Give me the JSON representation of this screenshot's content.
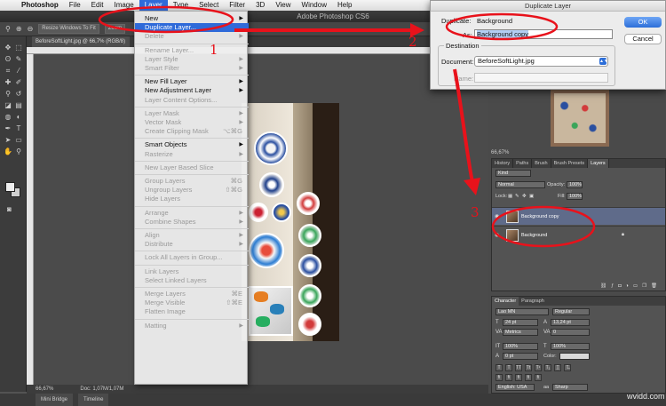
{
  "menubar": {
    "items": [
      "Photoshop",
      "File",
      "Edit",
      "Image",
      "Layer",
      "Type",
      "Select",
      "Filter",
      "3D",
      "View",
      "Window",
      "Help"
    ],
    "active": "Layer"
  },
  "titlebar": {
    "title": "Adobe Photoshop CS6"
  },
  "options": {
    "resize": "Resize Windows To Fit",
    "zoom": "Zoom"
  },
  "doc": {
    "tab": "BeforeSoftLight.jpg @ 66,7% (RGB/8)"
  },
  "layer_menu": {
    "items": [
      {
        "label": "New",
        "submenu": true
      },
      {
        "label": "Duplicate Layer...",
        "selected": true
      },
      {
        "label": "Delete",
        "disabled": true,
        "submenu": true
      },
      {
        "sep": true
      },
      {
        "label": "Rename Layer...",
        "disabled": true
      },
      {
        "label": "Layer Style",
        "disabled": true,
        "submenu": true
      },
      {
        "label": "Smart Filter",
        "disabled": true,
        "submenu": true
      },
      {
        "sep": true
      },
      {
        "label": "New Fill Layer",
        "submenu": true
      },
      {
        "label": "New Adjustment Layer",
        "submenu": true
      },
      {
        "label": "Layer Content Options...",
        "disabled": true
      },
      {
        "sep": true
      },
      {
        "label": "Layer Mask",
        "disabled": true,
        "submenu": true
      },
      {
        "label": "Vector Mask",
        "disabled": true,
        "submenu": true
      },
      {
        "label": "Create Clipping Mask",
        "disabled": true,
        "shortcut": "⌥⌘G"
      },
      {
        "sep": true
      },
      {
        "label": "Smart Objects",
        "submenu": true
      },
      {
        "label": "Rasterize",
        "disabled": true,
        "submenu": true
      },
      {
        "sep": true
      },
      {
        "label": "New Layer Based Slice",
        "disabled": true
      },
      {
        "sep": true
      },
      {
        "label": "Group Layers",
        "disabled": true,
        "shortcut": "⌘G"
      },
      {
        "label": "Ungroup Layers",
        "disabled": true,
        "shortcut": "⇧⌘G"
      },
      {
        "label": "Hide Layers",
        "disabled": true
      },
      {
        "sep": true
      },
      {
        "label": "Arrange",
        "disabled": true,
        "submenu": true
      },
      {
        "label": "Combine Shapes",
        "disabled": true,
        "submenu": true
      },
      {
        "sep": true
      },
      {
        "label": "Align",
        "disabled": true,
        "submenu": true
      },
      {
        "label": "Distribute",
        "disabled": true,
        "submenu": true
      },
      {
        "sep": true
      },
      {
        "label": "Lock All Layers in Group...",
        "disabled": true
      },
      {
        "sep": true
      },
      {
        "label": "Link Layers",
        "disabled": true
      },
      {
        "label": "Select Linked Layers",
        "disabled": true
      },
      {
        "sep": true
      },
      {
        "label": "Merge Layers",
        "disabled": true,
        "shortcut": "⌘E"
      },
      {
        "label": "Merge Visible",
        "disabled": true,
        "shortcut": "⇧⌘E"
      },
      {
        "label": "Flatten Image",
        "disabled": true
      },
      {
        "sep": true
      },
      {
        "label": "Matting",
        "disabled": true,
        "submenu": true
      }
    ]
  },
  "dialog": {
    "title": "Duplicate Layer",
    "duplicate_label": "Duplicate:",
    "duplicate_value": "Background",
    "as_label": "As:",
    "as_value": "Background copy",
    "ok": "OK",
    "cancel": "Cancel",
    "destination": "Destination",
    "document_label": "Document:",
    "document_value": "BeforeSoftLight.jpg",
    "name_label": "Name:"
  },
  "navigator": {
    "zoom": "66,67%"
  },
  "layers": {
    "tabs": [
      "History",
      "Paths",
      "Brush",
      "Brush Presets",
      "Layers"
    ],
    "active_tab": "Layers",
    "kind": "Kind",
    "blend": "Normal",
    "opacity_label": "Opacity:",
    "opacity": "100%",
    "lock_label": "Lock:",
    "fill_label": "Fill:",
    "fill": "100%",
    "list": [
      {
        "name": "Background copy",
        "selected": true
      },
      {
        "name": "Background",
        "selected": false
      }
    ]
  },
  "character": {
    "tabs": [
      "Character",
      "Paragraph"
    ],
    "font": "Lao MN",
    "style": "Regular",
    "size": "24 pt",
    "leading": "13,24 pt",
    "kerning": "Metrics",
    "tracking": "0",
    "vscale": "100%",
    "hscale": "100%",
    "baseline": "0 pt",
    "color_label": "Color:",
    "language": "English: USA",
    "aa": "aa",
    "aa_mode": "Sharp"
  },
  "status": {
    "zoom": "66,67%",
    "doc": "Doc: 1,07M/1,07M"
  },
  "bottom": {
    "tabs": [
      "Mini Bridge",
      "Timeline"
    ]
  },
  "watermark": "wvidd.com",
  "annotations": {
    "n1": "1",
    "n2": "2",
    "n3": "3"
  },
  "colors": {
    "accent": "#2f6ad9",
    "annotation": "#e8121b",
    "selected_layer": "#5f6b8a"
  }
}
